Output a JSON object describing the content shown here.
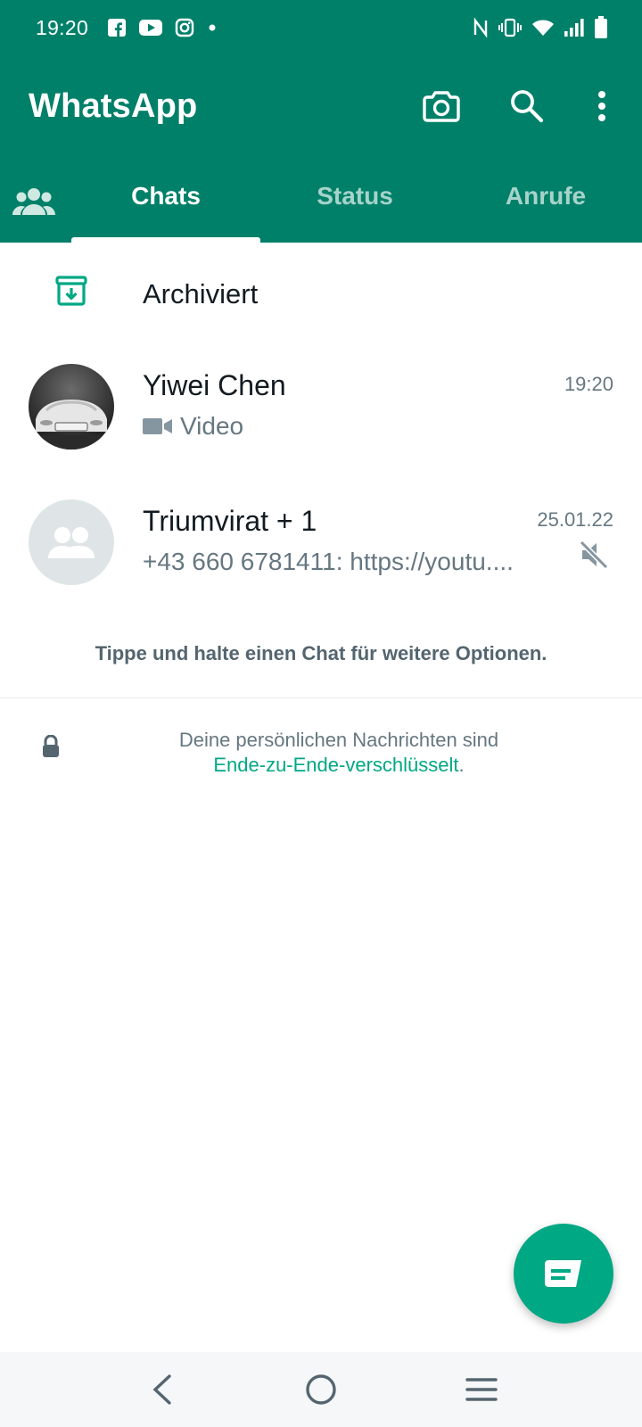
{
  "status_bar": {
    "time": "19:20",
    "left_icons": [
      "facebook-icon",
      "youtube-icon",
      "instagram-icon",
      "dot-icon"
    ],
    "right_icons": [
      "nfc-icon",
      "vibrate-icon",
      "wifi-icon",
      "signal-icon",
      "battery-icon"
    ]
  },
  "header": {
    "title": "WhatsApp",
    "actions": [
      "camera-icon",
      "search-icon",
      "more-vert-icon"
    ]
  },
  "tabs": {
    "community_icon": "community-icon",
    "items": [
      {
        "label": "Chats",
        "active": true
      },
      {
        "label": "Status",
        "active": false
      },
      {
        "label": "Anrufe",
        "active": false
      }
    ]
  },
  "archived": {
    "label": "Archiviert",
    "icon": "archive-icon"
  },
  "chats": [
    {
      "name": "Yiwei Chen",
      "time": "19:20",
      "preview": "Video",
      "preview_icon": "video-icon",
      "muted": false
    },
    {
      "name": "Triumvirat + 1",
      "time": "25.01.22",
      "preview": "+43 660 6781411: https://youtu....",
      "muted": true
    }
  ],
  "hint": "Tippe und halte einen Chat für weitere Optionen.",
  "encryption": {
    "line1": "Deine persönlichen Nachrichten sind",
    "link": "Ende-zu-Ende-verschlüsselt",
    "suffix": "."
  },
  "fab_icon": "new-chat-icon",
  "nav_bar": [
    "back-icon",
    "home-icon",
    "recents-icon"
  ],
  "colors": {
    "header": "#008069",
    "accent": "#00a884",
    "secondary_text": "#667781"
  }
}
